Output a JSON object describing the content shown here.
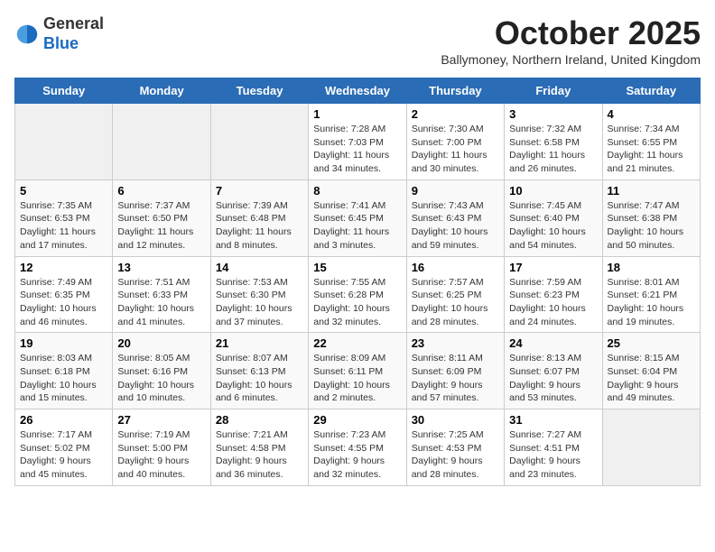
{
  "logo": {
    "general": "General",
    "blue": "Blue"
  },
  "header": {
    "month_title": "October 2025",
    "subtitle": "Ballymoney, Northern Ireland, United Kingdom"
  },
  "weekdays": [
    "Sunday",
    "Monday",
    "Tuesday",
    "Wednesday",
    "Thursday",
    "Friday",
    "Saturday"
  ],
  "weeks": [
    [
      {
        "day": "",
        "info": ""
      },
      {
        "day": "",
        "info": ""
      },
      {
        "day": "",
        "info": ""
      },
      {
        "day": "1",
        "info": "Sunrise: 7:28 AM\nSunset: 7:03 PM\nDaylight: 11 hours\nand 34 minutes."
      },
      {
        "day": "2",
        "info": "Sunrise: 7:30 AM\nSunset: 7:00 PM\nDaylight: 11 hours\nand 30 minutes."
      },
      {
        "day": "3",
        "info": "Sunrise: 7:32 AM\nSunset: 6:58 PM\nDaylight: 11 hours\nand 26 minutes."
      },
      {
        "day": "4",
        "info": "Sunrise: 7:34 AM\nSunset: 6:55 PM\nDaylight: 11 hours\nand 21 minutes."
      }
    ],
    [
      {
        "day": "5",
        "info": "Sunrise: 7:35 AM\nSunset: 6:53 PM\nDaylight: 11 hours\nand 17 minutes."
      },
      {
        "day": "6",
        "info": "Sunrise: 7:37 AM\nSunset: 6:50 PM\nDaylight: 11 hours\nand 12 minutes."
      },
      {
        "day": "7",
        "info": "Sunrise: 7:39 AM\nSunset: 6:48 PM\nDaylight: 11 hours\nand 8 minutes."
      },
      {
        "day": "8",
        "info": "Sunrise: 7:41 AM\nSunset: 6:45 PM\nDaylight: 11 hours\nand 3 minutes."
      },
      {
        "day": "9",
        "info": "Sunrise: 7:43 AM\nSunset: 6:43 PM\nDaylight: 10 hours\nand 59 minutes."
      },
      {
        "day": "10",
        "info": "Sunrise: 7:45 AM\nSunset: 6:40 PM\nDaylight: 10 hours\nand 54 minutes."
      },
      {
        "day": "11",
        "info": "Sunrise: 7:47 AM\nSunset: 6:38 PM\nDaylight: 10 hours\nand 50 minutes."
      }
    ],
    [
      {
        "day": "12",
        "info": "Sunrise: 7:49 AM\nSunset: 6:35 PM\nDaylight: 10 hours\nand 46 minutes."
      },
      {
        "day": "13",
        "info": "Sunrise: 7:51 AM\nSunset: 6:33 PM\nDaylight: 10 hours\nand 41 minutes."
      },
      {
        "day": "14",
        "info": "Sunrise: 7:53 AM\nSunset: 6:30 PM\nDaylight: 10 hours\nand 37 minutes."
      },
      {
        "day": "15",
        "info": "Sunrise: 7:55 AM\nSunset: 6:28 PM\nDaylight: 10 hours\nand 32 minutes."
      },
      {
        "day": "16",
        "info": "Sunrise: 7:57 AM\nSunset: 6:25 PM\nDaylight: 10 hours\nand 28 minutes."
      },
      {
        "day": "17",
        "info": "Sunrise: 7:59 AM\nSunset: 6:23 PM\nDaylight: 10 hours\nand 24 minutes."
      },
      {
        "day": "18",
        "info": "Sunrise: 8:01 AM\nSunset: 6:21 PM\nDaylight: 10 hours\nand 19 minutes."
      }
    ],
    [
      {
        "day": "19",
        "info": "Sunrise: 8:03 AM\nSunset: 6:18 PM\nDaylight: 10 hours\nand 15 minutes."
      },
      {
        "day": "20",
        "info": "Sunrise: 8:05 AM\nSunset: 6:16 PM\nDaylight: 10 hours\nand 10 minutes."
      },
      {
        "day": "21",
        "info": "Sunrise: 8:07 AM\nSunset: 6:13 PM\nDaylight: 10 hours\nand 6 minutes."
      },
      {
        "day": "22",
        "info": "Sunrise: 8:09 AM\nSunset: 6:11 PM\nDaylight: 10 hours\nand 2 minutes."
      },
      {
        "day": "23",
        "info": "Sunrise: 8:11 AM\nSunset: 6:09 PM\nDaylight: 9 hours\nand 57 minutes."
      },
      {
        "day": "24",
        "info": "Sunrise: 8:13 AM\nSunset: 6:07 PM\nDaylight: 9 hours\nand 53 minutes."
      },
      {
        "day": "25",
        "info": "Sunrise: 8:15 AM\nSunset: 6:04 PM\nDaylight: 9 hours\nand 49 minutes."
      }
    ],
    [
      {
        "day": "26",
        "info": "Sunrise: 7:17 AM\nSunset: 5:02 PM\nDaylight: 9 hours\nand 45 minutes."
      },
      {
        "day": "27",
        "info": "Sunrise: 7:19 AM\nSunset: 5:00 PM\nDaylight: 9 hours\nand 40 minutes."
      },
      {
        "day": "28",
        "info": "Sunrise: 7:21 AM\nSunset: 4:58 PM\nDaylight: 9 hours\nand 36 minutes."
      },
      {
        "day": "29",
        "info": "Sunrise: 7:23 AM\nSunset: 4:55 PM\nDaylight: 9 hours\nand 32 minutes."
      },
      {
        "day": "30",
        "info": "Sunrise: 7:25 AM\nSunset: 4:53 PM\nDaylight: 9 hours\nand 28 minutes."
      },
      {
        "day": "31",
        "info": "Sunrise: 7:27 AM\nSunset: 4:51 PM\nDaylight: 9 hours\nand 23 minutes."
      },
      {
        "day": "",
        "info": ""
      }
    ]
  ]
}
